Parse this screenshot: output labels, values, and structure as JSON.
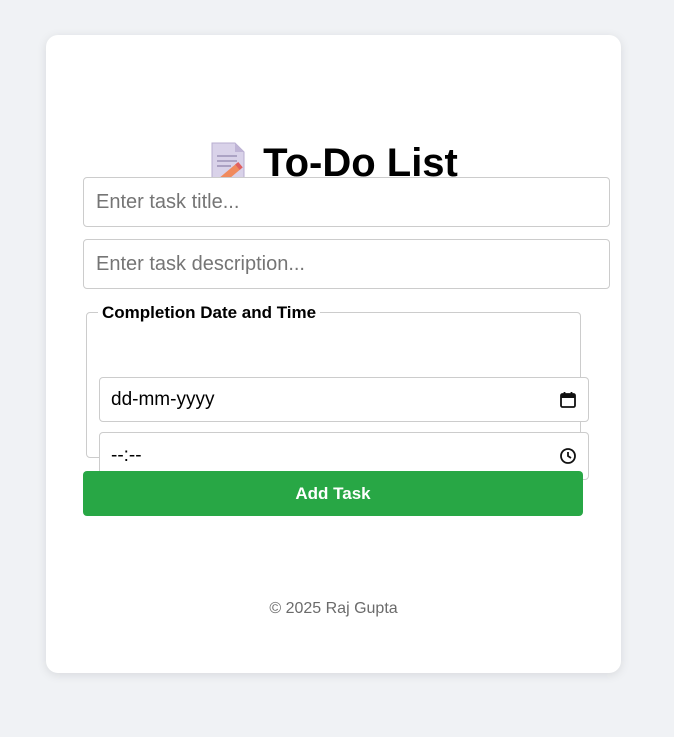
{
  "app": {
    "title": "To-Do List",
    "title_icon": "memo-icon"
  },
  "form": {
    "title_placeholder": "Enter task title...",
    "title_value": "",
    "description_placeholder": "Enter task description...",
    "description_value": "",
    "completion_legend": "Completion Date and Time",
    "date_display": "dd-mm-yyyy",
    "date_icon": "calendar-icon",
    "time_display": "--:--",
    "time_icon": "clock-icon",
    "add_button_label": "Add Task"
  },
  "footer": {
    "text": "© 2025 Raj Gupta"
  },
  "colors": {
    "background": "#f0f2f5",
    "card": "#ffffff",
    "accent_green": "#28a745",
    "border": "#cccccc"
  }
}
